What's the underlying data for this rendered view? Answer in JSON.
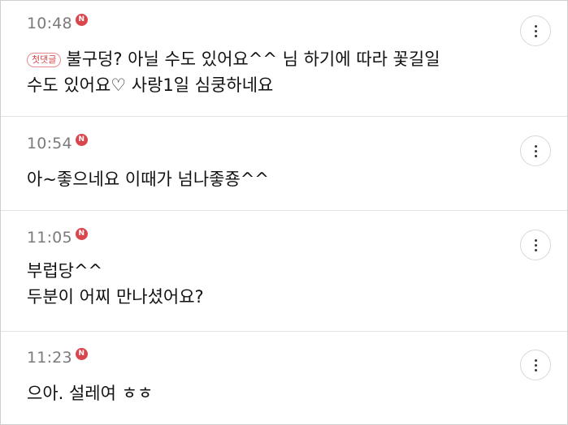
{
  "comments": [
    {
      "time": "10:48",
      "badge": "N",
      "first_tag": "첫댓글",
      "line1": "불구덩? 아닐 수도 있어요^^ 님 하기에 따라 꽃길일",
      "line2": "수도 있어요♡ 사랑1일 심쿵하네요"
    },
    {
      "time": "10:54",
      "badge": "N",
      "line1": "아~좋으네요 이때가 넘나좋죵^^"
    },
    {
      "time": "11:05",
      "badge": "N",
      "line1": "부럽당^^",
      "line2": "두분이 어찌 만나셨어요?"
    },
    {
      "time": "11:23",
      "badge": "N",
      "line1": "으아. 설레여 ㅎㅎ"
    }
  ],
  "colors": {
    "badge": "#d9464c",
    "time": "#7b7b7b",
    "divider": "#e3e3e3"
  }
}
